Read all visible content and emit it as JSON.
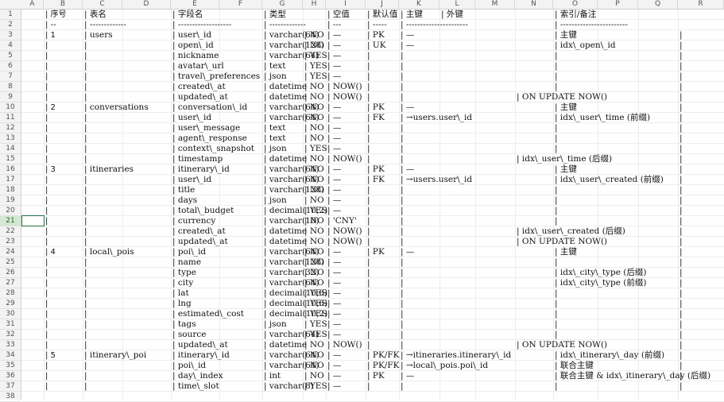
{
  "columns": [
    "A",
    "B",
    "C",
    "D",
    "E",
    "F",
    "G",
    "H",
    "I",
    "J",
    "K",
    "L",
    "M",
    "N",
    "O",
    "P",
    "Q",
    "R"
  ],
  "rows": [
    [
      "",
      "| 序号",
      "| 表名",
      "",
      "| 字段名",
      "",
      "| 类型",
      "",
      "| 空值",
      "| 默认值",
      "| 主键",
      "| 外键",
      "",
      "",
      "| 索引/备注",
      "",
      "",
      ""
    ],
    [
      "",
      "| --",
      "| -------------",
      "",
      "| -------------------",
      "",
      "| -------------",
      "",
      "| ---",
      "| -----",
      "| ----------------------",
      "",
      "",
      "",
      "| ------------------------",
      "",
      "",
      ""
    ],
    [
      "",
      "| 1",
      "| users",
      "",
      "| user\\_id",
      "",
      "| varchar(64)",
      "| NO",
      "| —",
      "| PK",
      "| —",
      "",
      "",
      "",
      "| 主键",
      "",
      "",
      "|"
    ],
    [
      "",
      "|",
      "|",
      "",
      "| open\\_id",
      "",
      "| varchar(128)",
      "| NO",
      "| —",
      "| UK",
      "| —",
      "",
      "",
      "",
      "| idx\\_open\\_id",
      "",
      "",
      "|"
    ],
    [
      "",
      "|",
      "|",
      "",
      "| nickname",
      "",
      "| varchar(64)",
      "| YES",
      "| —",
      "|",
      "|",
      "",
      "",
      "",
      "|",
      "",
      "",
      "|"
    ],
    [
      "",
      "|",
      "|",
      "",
      "| avatar\\_url",
      "",
      "| text",
      "| YES",
      "| —",
      "|",
      "|",
      "",
      "",
      "",
      "|",
      "",
      "",
      "|"
    ],
    [
      "",
      "|",
      "|",
      "",
      "| travel\\_preferences",
      "",
      "| json",
      "| YES",
      "| —",
      "|",
      "|",
      "",
      "",
      "",
      "|",
      "",
      "",
      "|"
    ],
    [
      "",
      "|",
      "|",
      "",
      "| created\\_at",
      "",
      "| datetime",
      "| NO",
      "| NOW()",
      "|",
      "|",
      "",
      "",
      "",
      "|",
      "",
      "",
      "|"
    ],
    [
      "",
      "|",
      "|",
      "",
      "| updated\\_at",
      "",
      "| datetime",
      "| NO",
      "| NOW()",
      "|",
      "|",
      "",
      "",
      "| ON UPDATE NOW()",
      "",
      "",
      "",
      "|"
    ],
    [
      "",
      "| 2",
      "| conversations",
      "",
      "| conversation\\_id",
      "",
      "| varchar(64)",
      "| NO",
      "| —",
      "| PK",
      "| —",
      "",
      "",
      "",
      "| 主键",
      "",
      "",
      "|"
    ],
    [
      "",
      "|",
      "|",
      "",
      "| user\\_id",
      "",
      "| varchar(64)",
      "| NO",
      "| —",
      "| FK",
      "| →users.user\\_id",
      "",
      "",
      "",
      "| idx\\_user\\_time (前缀)",
      "",
      "",
      "|"
    ],
    [
      "",
      "|",
      "|",
      "",
      "| user\\_message",
      "",
      "| text",
      "| NO",
      "| —",
      "|",
      "|",
      "",
      "",
      "",
      "|",
      "",
      "",
      "|"
    ],
    [
      "",
      "|",
      "|",
      "",
      "| agent\\_response",
      "",
      "| text",
      "| NO",
      "| —",
      "|",
      "|",
      "",
      "",
      "",
      "|",
      "",
      "",
      "|"
    ],
    [
      "",
      "|",
      "|",
      "",
      "| context\\_snapshot",
      "",
      "| json",
      "| YES",
      "| —",
      "|",
      "|",
      "",
      "",
      "",
      "|",
      "",
      "",
      "|"
    ],
    [
      "",
      "|",
      "|",
      "",
      "| timestamp",
      "",
      "| datetime",
      "| NO",
      "| NOW()",
      "|",
      "|",
      "",
      "",
      "| idx\\_user\\_time (后缀)",
      "",
      "",
      "",
      "|"
    ],
    [
      "",
      "| 3",
      "| itineraries",
      "",
      "| itinerary\\_id",
      "",
      "| varchar(64)",
      "| NO",
      "| —",
      "| PK",
      "| —",
      "",
      "",
      "",
      "| 主键",
      "",
      "",
      "|"
    ],
    [
      "",
      "|",
      "|",
      "",
      "| user\\_id",
      "",
      "| varchar(64)",
      "| NO",
      "| —",
      "| FK",
      "| →users.user\\_id",
      "",
      "",
      "",
      "| idx\\_user\\_created (前缀)",
      "",
      "",
      "|"
    ],
    [
      "",
      "|",
      "|",
      "",
      "| title",
      "",
      "| varchar(128)",
      "| NO",
      "| —",
      "|",
      "|",
      "",
      "",
      "",
      "|",
      "",
      "",
      "|"
    ],
    [
      "",
      "|",
      "|",
      "",
      "| days",
      "",
      "| json",
      "| NO",
      "| —",
      "|",
      "|",
      "",
      "",
      "",
      "|",
      "",
      "",
      "|"
    ],
    [
      "",
      "|",
      "|",
      "",
      "| total\\_budget",
      "",
      "| decimal(10,2)",
      "| YES",
      "| —",
      "|",
      "|",
      "",
      "",
      "",
      "|",
      "",
      "",
      "|"
    ],
    [
      "",
      "|",
      "|",
      "",
      "| currency",
      "",
      "| varchar(10)",
      "| NO",
      "| 'CNY'",
      "|",
      "|",
      "",
      "",
      "",
      "|",
      "",
      "",
      "|"
    ],
    [
      "",
      "|",
      "|",
      "",
      "| created\\_at",
      "",
      "| datetime",
      "| NO",
      "| NOW()",
      "|",
      "|",
      "",
      "",
      "| idx\\_user\\_created (后缀)",
      "",
      "",
      "",
      "|"
    ],
    [
      "",
      "|",
      "|",
      "",
      "| updated\\_at",
      "",
      "| datetime",
      "| NO",
      "| NOW()",
      "|",
      "|",
      "",
      "",
      "| ON UPDATE NOW()",
      "",
      "",
      "",
      "|"
    ],
    [
      "",
      "| 4",
      "| local\\_pois",
      "",
      "| poi\\_id",
      "",
      "| varchar(64)",
      "| NO",
      "| —",
      "| PK",
      "| —",
      "",
      "",
      "",
      "| 主键",
      "",
      "",
      "|"
    ],
    [
      "",
      "|",
      "|",
      "",
      "| name",
      "",
      "| varchar(128)",
      "| NO",
      "| —",
      "|",
      "|",
      "",
      "",
      "",
      "|",
      "",
      "",
      "|"
    ],
    [
      "",
      "|",
      "|",
      "",
      "| type",
      "",
      "| varchar(32)",
      "| NO",
      "| —",
      "|",
      "|",
      "",
      "",
      "",
      "| idx\\_city\\_type (后缀)",
      "",
      "",
      "|"
    ],
    [
      "",
      "|",
      "|",
      "",
      "| city",
      "",
      "| varchar(64)",
      "| NO",
      "| —",
      "|",
      "|",
      "",
      "",
      "",
      "| idx\\_city\\_type (前缀)",
      "",
      "",
      "|"
    ],
    [
      "",
      "|",
      "|",
      "",
      "| lat",
      "",
      "| decimal(10,6)",
      "| YES",
      "| —",
      "|",
      "|",
      "",
      "",
      "",
      "|",
      "",
      "",
      "|"
    ],
    [
      "",
      "|",
      "|",
      "",
      "| lng",
      "",
      "| decimal(10,6)",
      "| YES",
      "| —",
      "|",
      "|",
      "",
      "",
      "",
      "|",
      "",
      "",
      "|"
    ],
    [
      "",
      "|",
      "|",
      "",
      "| estimated\\_cost",
      "",
      "| decimal(10,2)",
      "| YES",
      "| —",
      "|",
      "|",
      "",
      "",
      "",
      "|",
      "",
      "",
      "|"
    ],
    [
      "",
      "|",
      "|",
      "",
      "| tags",
      "",
      "| json",
      "| YES",
      "| —",
      "|",
      "|",
      "",
      "",
      "",
      "|",
      "",
      "",
      "|"
    ],
    [
      "",
      "|",
      "|",
      "",
      "| source",
      "",
      "| varchar(64)",
      "| YES",
      "| —",
      "|",
      "|",
      "",
      "",
      "",
      "|",
      "",
      "",
      "|"
    ],
    [
      "",
      "|",
      "|",
      "",
      "| updated\\_at",
      "",
      "| datetime",
      "| NO",
      "| NOW()",
      "|",
      "|",
      "",
      "",
      "| ON UPDATE NOW()",
      "",
      "",
      "",
      "|"
    ],
    [
      "",
      "| 5",
      "| itinerary\\_poi",
      "",
      "| itinerary\\_id",
      "",
      "| varchar(64)",
      "| NO",
      "| —",
      "| PK/FK",
      "| →itineraries.itinerary\\_id",
      "",
      "",
      "",
      "| idx\\_itinerary\\_day (前缀)",
      "",
      "",
      "|"
    ],
    [
      "",
      "|",
      "|",
      "",
      "| poi\\_id",
      "",
      "| varchar(64)",
      "| NO",
      "| —",
      "| PK/FK",
      "| →local\\_pois.poi\\_id",
      "",
      "",
      "",
      "| 联合主键",
      "",
      "",
      "|"
    ],
    [
      "",
      "|",
      "|",
      "",
      "| day\\_index",
      "",
      "| int",
      "| NO",
      "| —",
      "| PK",
      "| —",
      "",
      "",
      "",
      "| 联合主键 & idx\\_itinerary\\_day (后缀)",
      "",
      "",
      "|"
    ],
    [
      "",
      "|",
      "|",
      "",
      "| time\\_slot",
      "",
      "| varchar(8)",
      "| YES",
      "| —",
      "|",
      "|",
      "",
      "",
      "",
      "|",
      "",
      "",
      "|"
    ]
  ],
  "row_numbers": [
    "1",
    "2",
    "3",
    "4",
    "5",
    "6",
    "7",
    "8",
    "9",
    "10",
    "11",
    "12",
    "13",
    "14",
    "15",
    "16",
    "17",
    "18",
    "19",
    "20",
    "21",
    "22",
    "23",
    "24",
    "25",
    "26",
    "27",
    "28",
    "29",
    "30",
    "31",
    "32",
    "33",
    "34",
    "35",
    "36",
    "37",
    "38"
  ],
  "selected_row": "21",
  "colors": {
    "header_bg": "#f3f3f3",
    "selection": "#217346"
  }
}
